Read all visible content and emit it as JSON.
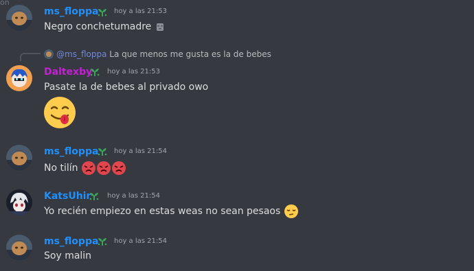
{
  "top_fragment": "ón",
  "colors": {
    "ms_floppa": "#1e90ff",
    "daltexby": "#c61fd6",
    "katsuhir": "#1e90ff",
    "mention": "#7289da",
    "sprout": "#3ba55c",
    "angry": "#e0464e"
  },
  "messages": [
    {
      "username": "ms_floppa",
      "badge_icon": "sprout-icon",
      "timestamp": "hoy a las 21:53",
      "text": "Negro conchetumadre",
      "trailing_emoji": "moai-emoji"
    },
    {
      "reply": {
        "mention": "@ms_floppa",
        "text": "La que menos me gusta es la de bebes"
      },
      "username": "Daltexby",
      "badge_icon": "sprout-icon",
      "timestamp": "hoy a las 21:53",
      "text": "Pasate la de bebes al privado owo",
      "big_emoji": "yum-emoji"
    },
    {
      "username": "ms_floppa",
      "badge_icon": "sprout-icon",
      "timestamp": "hoy a las 21:54",
      "text": "No tilín",
      "trailing_emoji": "rage-emoji x3"
    },
    {
      "username": "KatsUhir",
      "badge_icon": "sprout-icon",
      "timestamp": "hoy a las 21:54",
      "text": "Yo recién empiezo en estas weas no sean pesaos",
      "trailing_emoji": "pensive-emoji"
    },
    {
      "username": "ms_floppa",
      "badge_icon": "sprout-icon",
      "timestamp": "hoy a las 21:54",
      "text": "Soy malin"
    }
  ]
}
